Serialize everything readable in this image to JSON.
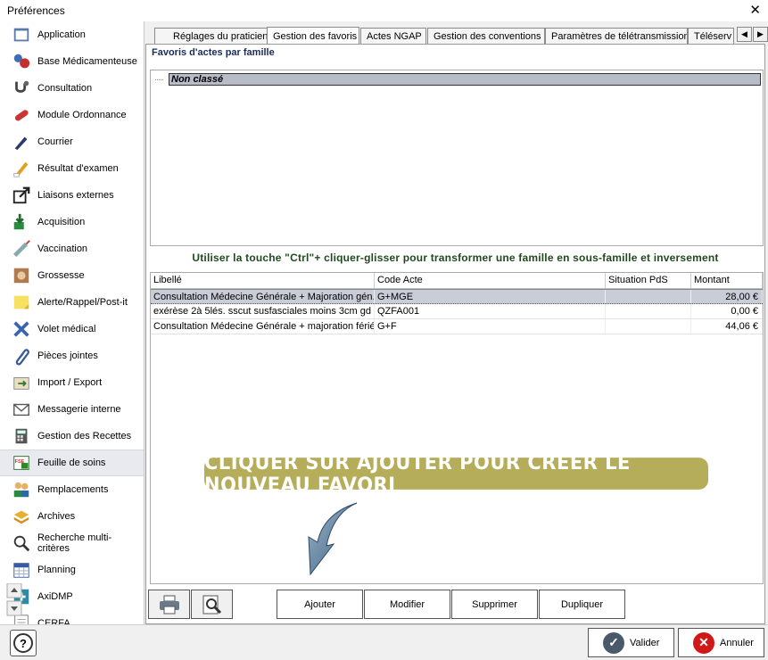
{
  "window": {
    "title": "Préférences",
    "close_glyph": "✕"
  },
  "sidebar": {
    "items": [
      {
        "label": "Application",
        "icon": "application-icon"
      },
      {
        "label": "Base Médicamenteuse",
        "icon": "medication-base-icon"
      },
      {
        "label": "Consultation",
        "icon": "stethoscope-icon"
      },
      {
        "label": "Module Ordonnance",
        "icon": "pill-icon"
      },
      {
        "label": "Courrier",
        "icon": "pen-icon"
      },
      {
        "label": "Résultat d'examen",
        "icon": "pencil-icon"
      },
      {
        "label": "Liaisons externes",
        "icon": "external-link-icon"
      },
      {
        "label": "Acquisition",
        "icon": "acquisition-icon"
      },
      {
        "label": "Vaccination",
        "icon": "syringe-icon"
      },
      {
        "label": "Grossesse",
        "icon": "pregnancy-icon"
      },
      {
        "label": "Alerte/Rappel/Post-it",
        "icon": "post-it-icon"
      },
      {
        "label": "Volet médical",
        "icon": "cross-icon"
      },
      {
        "label": "Pièces jointes",
        "icon": "paperclip-icon"
      },
      {
        "label": "Import / Export",
        "icon": "import-export-icon"
      },
      {
        "label": "Messagerie interne",
        "icon": "mail-icon"
      },
      {
        "label": "Gestion des Recettes",
        "icon": "calculator-icon"
      },
      {
        "label": "Feuille de soins",
        "icon": "care-sheet-icon"
      },
      {
        "label": "Remplacements",
        "icon": "people-icon"
      },
      {
        "label": "Archives",
        "icon": "archive-icon"
      },
      {
        "label": "Recherche multi-critères",
        "icon": "search-icon"
      },
      {
        "label": "Planning",
        "icon": "calendar-icon"
      },
      {
        "label": "AxiDMP",
        "icon": "dmp-icon"
      },
      {
        "label": "CERFA",
        "icon": "cerfa-icon"
      }
    ],
    "active_index": 16
  },
  "tabs": [
    {
      "label": "Réglages du praticien"
    },
    {
      "label": "Gestion des favoris"
    },
    {
      "label": "Actes NGAP"
    },
    {
      "label": "Gestion des conventions"
    },
    {
      "label": "Paramètres de télétransmission"
    },
    {
      "label": "Téléserv"
    }
  ],
  "panel": {
    "title": "Favoris d'actes par famille",
    "tree_root": "Non classé",
    "hint": "Utiliser la touche \"Ctrl\"+ cliquer-glisser pour transformer une famille en sous-famille et inversement"
  },
  "grid": {
    "columns": [
      "Libellé",
      "Code Acte",
      "Situation PdS",
      "Montant"
    ],
    "rows": [
      [
        "Consultation Médecine Générale + Majoration gén...",
        "G+MGE",
        "",
        "28,00 €"
      ],
      [
        "exérèse 2à 5lés. sscut susfasciales moins 3cm gd ...",
        "QZFA001",
        "",
        "0,00 €"
      ],
      [
        "Consultation Médecine Générale + majoration férié",
        "G+F",
        "",
        "44,06 €"
      ]
    ]
  },
  "callout": "CLIQUER SUR AJOUTER POUR CRÉER LE NOUVEAU FAVORI",
  "actions": {
    "add": "Ajouter",
    "edit": "Modifier",
    "delete": "Supprimer",
    "duplicate": "Dupliquer"
  },
  "footer": {
    "validate": "Valider",
    "cancel": "Annuler"
  },
  "colors": {
    "callout_bg": "#b5ad59",
    "hint_text": "#1f4a1f",
    "validate_icon": "#4a5a6a",
    "cancel_icon": "#d01818"
  }
}
